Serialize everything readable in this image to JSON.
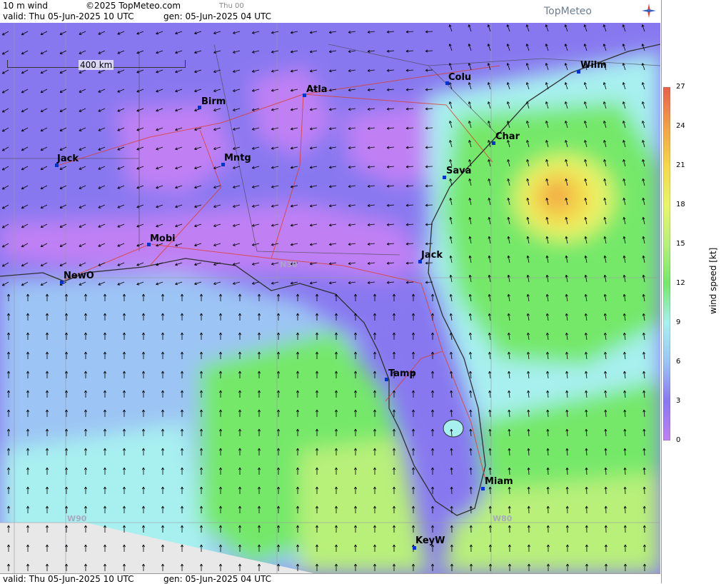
{
  "header": {
    "variable": "10 m wind",
    "copyright": "©2025 TopMeteo.com",
    "frame_label": "Thu 00",
    "valid": "valid:  Thu  05-Jun-2025  10 UTC",
    "gen": "gen: 05-Jun-2025 04 UTC",
    "brand": "TopMeteo"
  },
  "footer": {
    "valid": "valid:  Thu  05-Jun-2025  10 UTC",
    "gen": "gen: 05-Jun-2025 04 UTC"
  },
  "scale": {
    "label": "400 km"
  },
  "legend": {
    "axis_title": "wind speed [kt]",
    "ticks": [
      "27",
      "24",
      "21",
      "18",
      "15",
      "12",
      "9",
      "6",
      "3",
      "0"
    ],
    "colors": [
      "#e8604c",
      "#f2a048",
      "#f4d84a",
      "#e8f56a",
      "#b8f07a",
      "#74e86a",
      "#a8f0f0",
      "#9cc4f4",
      "#8878f0",
      "#c080f4"
    ]
  },
  "cities": [
    {
      "name": "Atla"
    },
    {
      "name": "Birm"
    },
    {
      "name": "Colu"
    },
    {
      "name": "Wilm"
    },
    {
      "name": "Char"
    },
    {
      "name": "Sava"
    },
    {
      "name": "Jack"
    },
    {
      "name": "Mntg"
    },
    {
      "name": "Mobi"
    },
    {
      "name": "NewO"
    },
    {
      "name": "Jack"
    },
    {
      "name": "Tamp"
    },
    {
      "name": "Miam"
    },
    {
      "name": "KeyW"
    }
  ],
  "grid_labels": {
    "n30": "N30",
    "w90": "W90",
    "w80": "W80"
  }
}
